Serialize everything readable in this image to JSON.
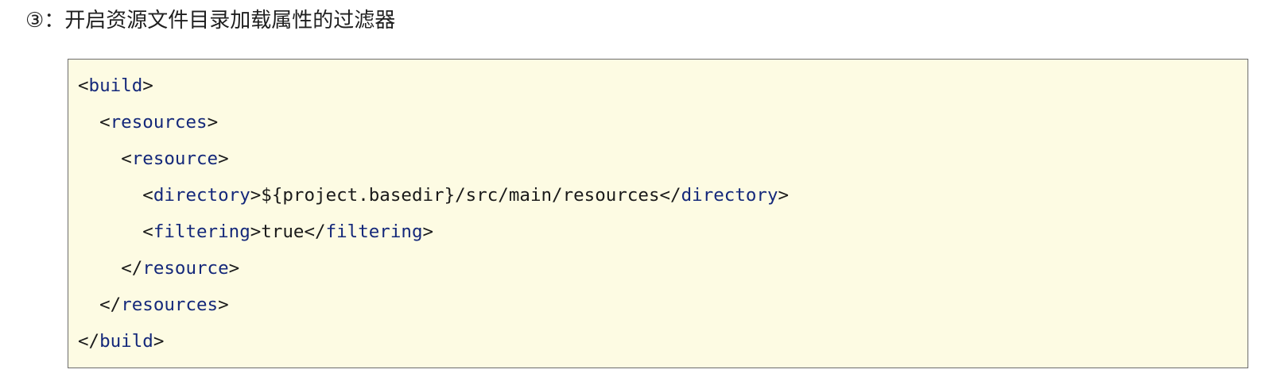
{
  "heading": "③：开启资源文件目录加载属性的过滤器",
  "code": {
    "language": "xml",
    "lines": [
      {
        "indent": "",
        "open": "<",
        "tag": "build",
        "close": ">",
        "text": "",
        "open2": "",
        "tag2": "",
        "close2": ""
      },
      {
        "indent": "  ",
        "open": "<",
        "tag": "resources",
        "close": ">",
        "text": "",
        "open2": "",
        "tag2": "",
        "close2": ""
      },
      {
        "indent": "    ",
        "open": "<",
        "tag": "resource",
        "close": ">",
        "text": "",
        "open2": "",
        "tag2": "",
        "close2": ""
      },
      {
        "indent": "      ",
        "open": "<",
        "tag": "directory",
        "close": ">",
        "text": "${project.basedir}/src/main/resources",
        "open2": "</",
        "tag2": "directory",
        "close2": ">"
      },
      {
        "indent": "      ",
        "open": "<",
        "tag": "filtering",
        "close": ">",
        "text": "true",
        "open2": "</",
        "tag2": "filtering",
        "close2": ">"
      },
      {
        "indent": "    ",
        "open": "</",
        "tag": "resource",
        "close": ">",
        "text": "",
        "open2": "",
        "tag2": "",
        "close2": ""
      },
      {
        "indent": "  ",
        "open": "</",
        "tag": "resources",
        "close": ">",
        "text": "",
        "open2": "",
        "tag2": "",
        "close2": ""
      },
      {
        "indent": "",
        "open": "</",
        "tag": "build",
        "close": ">",
        "text": "",
        "open2": "",
        "tag2": "",
        "close2": ""
      }
    ]
  },
  "colors": {
    "code_background": "#fdfbe3",
    "code_border": "#6c6c6c",
    "tag_name": "#14287a",
    "text": "#1a1a1a"
  }
}
